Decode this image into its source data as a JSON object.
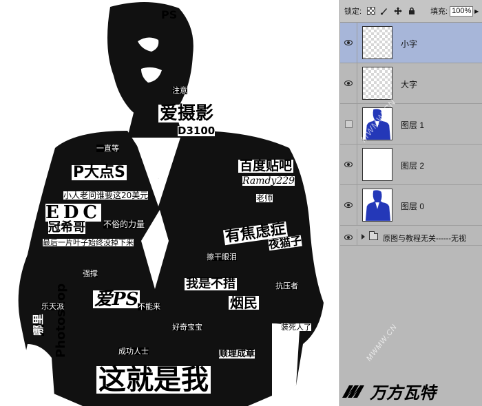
{
  "canvas": {
    "words": {
      "ps": "PS",
      "ai_she_ying": "爱摄影",
      "d3100": "D3100",
      "p_da_dian_s": "P大点S",
      "bai_du_tie_ba": "百度贴吧",
      "ramdy": "Ramdy229",
      "twenty_yuan": "小人老问谁要这20美元",
      "edc": "EDC",
      "guan_xi_ge": "冠希哥",
      "bu_wei_li_liang": "不俗的力量",
      "you_jiao_lv": "有焦虑症",
      "ye_mao_zi": "夜猫子",
      "last_line": "最后一片叶子始终没掉下来",
      "wo_shi_bu_zhe": "我是不措",
      "yan_min": "烟民",
      "ai_ps": "爱PS",
      "photoshop": "Photoshop",
      "na_zhi": "哪里",
      "zhe_jiu_shi_wo": "这就是我",
      "shun_li_cheng_zhang": "顺理成章",
      "cheng_gong_ren_shi": "成功人士",
      "lao_shi": "老师",
      "jie_yu_lei": "擦干眼泪",
      "qiang_cheng": "强撑",
      "kuang_jia": "抗压者",
      "le_xiao": "乐天派",
      "zhuang_ru": "装死人了",
      "zhao_xu": "好奇宝宝",
      "bu_neng_lai": "不能来",
      "zhu_yi": "注意",
      "yi_zhi": "一直等"
    }
  },
  "layers_panel": {
    "lock_label": "锁定:",
    "fill_label": "填充:",
    "fill_value": "100%",
    "layers": [
      {
        "name": "小字",
        "visible": true,
        "selected": true,
        "thumb": "transparent"
      },
      {
        "name": "大字",
        "visible": true,
        "selected": false,
        "thumb": "transparent"
      },
      {
        "name": "图层 1",
        "visible": false,
        "selected": false,
        "thumb": "blue-figure"
      },
      {
        "name": "图层 2",
        "visible": true,
        "selected": false,
        "thumb": "white"
      },
      {
        "name": "图层 0",
        "visible": true,
        "selected": false,
        "thumb": "blue-figure"
      }
    ],
    "group": {
      "name": "原图与教程无关------无视"
    }
  },
  "watermarks": {
    "side": "MWMW.CN",
    "bottom": "MWMW.CN"
  },
  "brand": {
    "text": "MW 万方瓦特",
    "color": "#000000"
  }
}
